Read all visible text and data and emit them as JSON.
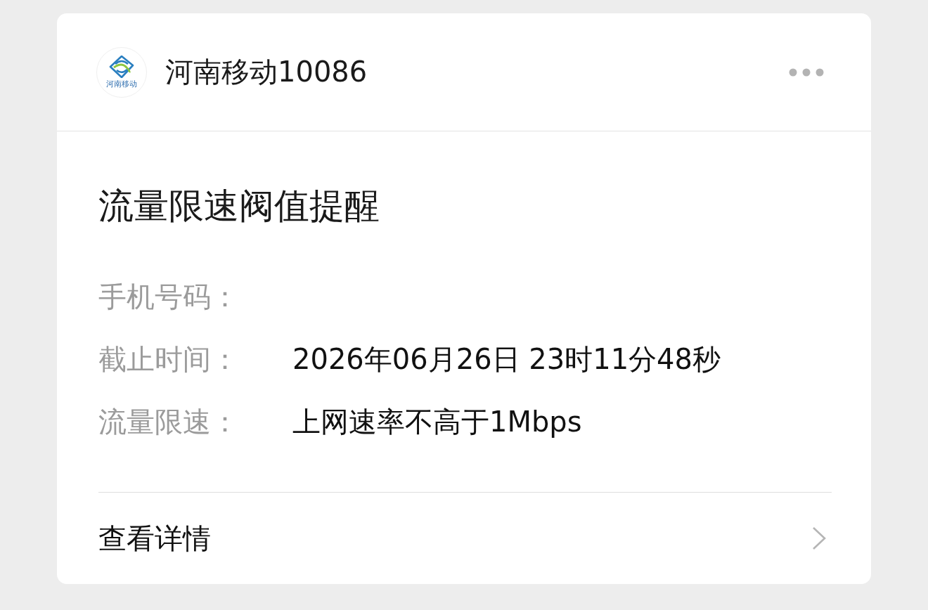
{
  "header": {
    "logo_text": "河南移动",
    "title": "河南移动10086"
  },
  "message": {
    "title": "流量限速阀值提醒",
    "fields": [
      {
        "label": "手机号码："
      },
      {
        "label": "截止时间：",
        "value": "2026年06月26日 23时11分48秒"
      },
      {
        "label": "流量限速：",
        "value": "上网速率不高于1Mbps"
      }
    ]
  },
  "footer": {
    "link": "查看详情"
  }
}
